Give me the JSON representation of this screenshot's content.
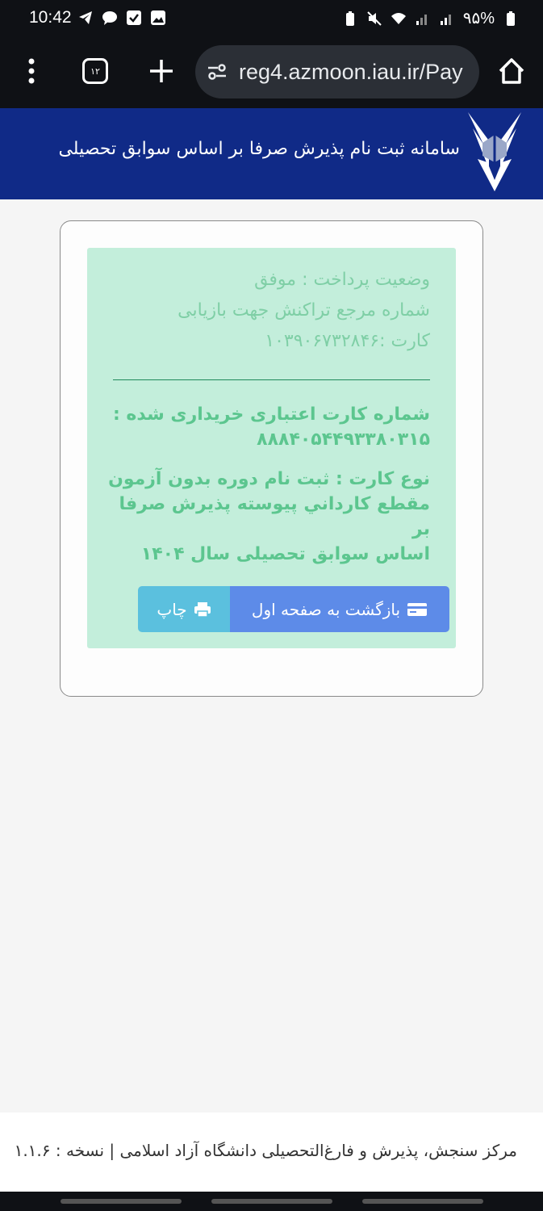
{
  "status_bar": {
    "time": "10:42",
    "battery_text": "۹۵%",
    "icons_left": [
      "telegram-icon",
      "chat-icon",
      "check-icon",
      "image-icon"
    ],
    "icons_right": [
      "battery-saver-icon",
      "mute-icon",
      "wifi-icon",
      "signal-icon",
      "signal-icon",
      "battery-icon"
    ]
  },
  "browser": {
    "tab_count": "۱۲",
    "url": "reg4.azmoon.iau.ir/Pay"
  },
  "header": {
    "title": "سامانه ثبت نام پذیرش صرفا بر اساس سوابق تحصیلی",
    "brand_color": "#102a87"
  },
  "payment": {
    "status_line": "وضعیت پرداخت : موفق",
    "reference_line1": "شماره مرجع تراکنش جهت بازیابی",
    "reference_line2": "کارت :۱۰۳۹۰۶۷۳۲۸۴۶",
    "card_number_label": "شماره کارت اعتباری خریداری شده :",
    "card_number_value": "۸۸۸۴۰۵۴۴۹۳۳۸۰۳۱۵",
    "card_type_line1": "نوع کارت : ثبت نام دوره بدون آزمون",
    "card_type_line2": "مقطع كارداني پيوسته پذیرش صرفا بر",
    "card_type_line3": "اساس سوابق تحصیلی سال ۱۴۰۴"
  },
  "buttons": {
    "back_label": "بازگشت به صفحه اول",
    "print_label": "چاپ"
  },
  "footer": {
    "text": "مرکز سنجش، پذیرش و فارغ‌التحصیلی دانشگاه آزاد اسلامی | نسخه : ۱.۱.۶"
  }
}
